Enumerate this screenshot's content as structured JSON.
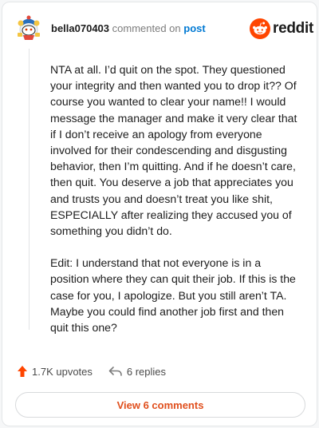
{
  "comment": {
    "username": "bella070403",
    "action_text": "commented on",
    "post_link": "post",
    "paragraphs": [
      "NTA at all. I’d quit on the spot. They questioned your integrity and then wanted you to drop it?? Of course you wanted to clear your name!! I would message the manager and make it very clear that if I don’t receive an apology from everyone involved for their condescending and disgusting behavior, then I’m quitting. And if he doesn’t care, then quit. You deserve a job that appreciates you and trusts you and doesn’t treat you like shit, ESPECIALLY after realizing they accused you of something you didn’t do.",
      "Edit: I understand that not everyone is in a position where they can quit their job. If this is the case for you, I apologize. But you still aren’t TA. Maybe you could find another job first and then quit this one?"
    ]
  },
  "brand": {
    "name": "reddit",
    "icon": "reddit-logo-icon",
    "accent_color": "#ff4500"
  },
  "footer": {
    "upvotes": "1.7K upvotes",
    "replies": "6 replies",
    "upvote_icon": "upvote-arrow-icon",
    "reply_icon": "reply-arrow-icon"
  },
  "view_comments_label": "View 6 comments"
}
